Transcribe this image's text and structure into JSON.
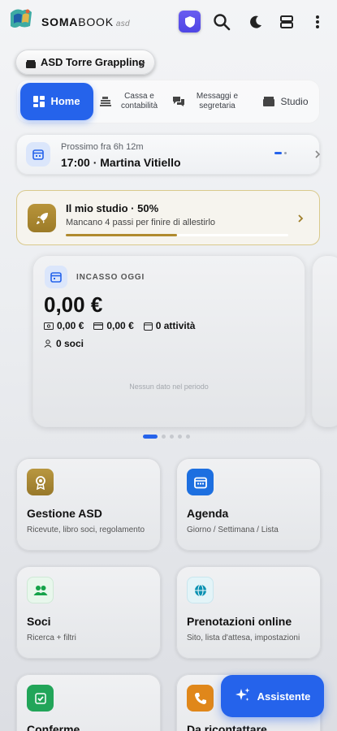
{
  "header": {
    "brand_bold": "SOMA",
    "brand_light": "BOOK",
    "brand_suffix": "asd",
    "icons": [
      "shield-icon",
      "search-icon",
      "moon-icon",
      "layout-icon",
      "more-vertical-icon"
    ],
    "accent": "#4f46e5"
  },
  "org_selector": {
    "value": "ASD Torre Grappling"
  },
  "tabs": [
    {
      "label": "Home",
      "active": true
    },
    {
      "label": "Cassa e contabilità",
      "active": false
    },
    {
      "label": "Messaggi e segretaria",
      "active": false
    },
    {
      "label": "Studio",
      "active": false
    }
  ],
  "next_event": {
    "subtitle": "Prossimo fra 6h 12m",
    "title": "17:00 · Martina Vitiello"
  },
  "studio": {
    "title": "Il mio studio · 50%",
    "subtitle": "Mancano 4 passi per finire di allestirlo",
    "progress": 0.5,
    "color": "#b08a2e"
  },
  "kpi": {
    "label": "INCASSO OGGI",
    "value": "0,00 €",
    "cash": "0,00 €",
    "card": "0,00 €",
    "activities": "0 attività",
    "members": "0 soci",
    "empty": "Nessun dato nel periodo"
  },
  "carousel": {
    "pages": 5,
    "current": 1
  },
  "tiles": [
    {
      "title": "Gestione ASD",
      "subtitle": "Ricevute, libro soci, regolamento",
      "icon": "award-icon",
      "color": "#a8842f"
    },
    {
      "title": "Agenda",
      "subtitle": "Giorno / Settimana / Lista",
      "icon": "calendar-icon",
      "color": "#1d6fe0"
    },
    {
      "title": "Soci",
      "subtitle": "Ricerca + filtri",
      "icon": "users-icon",
      "color": "#16a34a"
    },
    {
      "title": "Prenotazioni online",
      "subtitle": "Sito, lista d'attesa, impostazioni",
      "icon": "globe-icon",
      "color": "#0891b2"
    },
    {
      "title": "Conferme",
      "subtitle": "",
      "icon": "check-icon",
      "color": "#22a559"
    },
    {
      "title": "Da ricontattare",
      "subtitle": "",
      "icon": "phone-icon",
      "color": "#e0871a"
    }
  ],
  "assistant_button": {
    "label": "Assistente"
  }
}
